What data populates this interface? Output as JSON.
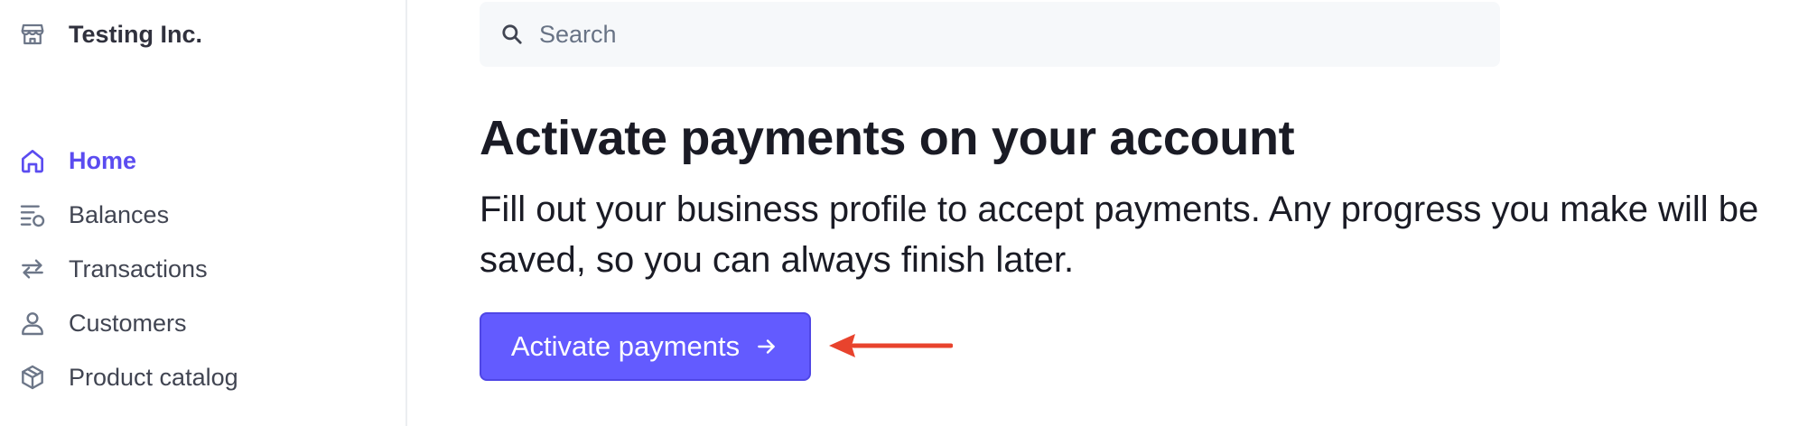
{
  "account": {
    "name": "Testing Inc.",
    "icon": "store-icon"
  },
  "sidebar": {
    "items": [
      {
        "label": "Home",
        "icon": "home-icon",
        "active": true
      },
      {
        "label": "Balances",
        "icon": "balances-icon",
        "active": false
      },
      {
        "label": "Transactions",
        "icon": "transactions-icon",
        "active": false
      },
      {
        "label": "Customers",
        "icon": "customer-icon",
        "active": false
      },
      {
        "label": "Product catalog",
        "icon": "product-box-icon",
        "active": false
      }
    ]
  },
  "search": {
    "placeholder": "Search",
    "value": ""
  },
  "main": {
    "headline": "Activate payments on your account",
    "description": "Fill out your business profile to accept payments. Any progress you make will be saved, so you can always finish later.",
    "cta_label": "Activate payments"
  },
  "colors": {
    "accent": "#635bff",
    "active_nav": "#5b4cf0",
    "annotation_arrow": "#e8432d",
    "search_background": "#f6f8fa"
  }
}
